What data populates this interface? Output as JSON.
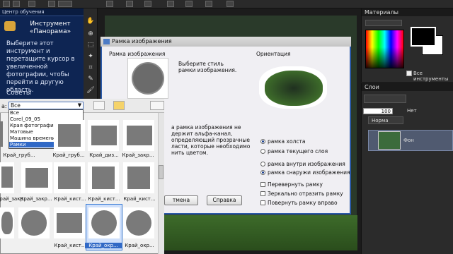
{
  "learning_center": {
    "header": "Центр обучения",
    "title": "Инструмент «Панорама»",
    "body": "Выберите этот инструмент и перетащите курсор в увеличенной фотографии, чтобы перейти в другую область.",
    "tips": "Советы"
  },
  "materials": {
    "header": "Материалы",
    "all_tools": "Все инструменты"
  },
  "layers": {
    "header": "Слои",
    "opacity": "100",
    "none_label": "Нет",
    "blend_mode": "Норма",
    "layer_name": "Фон"
  },
  "dialog": {
    "title": "Рамка изображения",
    "frame_section": "Рамка изображения",
    "choose_text": "Выберите стиль рамки изображения.",
    "orientation_section": "Ориентация",
    "info_text": "а рамка изображения не держит альфа-канал, определяющий прозрачные ласти, которые необходимо нить цветом.",
    "options": [
      {
        "label": "рамка холста",
        "type": "radio",
        "checked": true
      },
      {
        "label": "рамка текущего слоя",
        "type": "radio",
        "checked": false
      },
      {
        "label": "рамка внутри изображения",
        "type": "radio",
        "checked": false
      },
      {
        "label": "рамка снаружи изображения",
        "type": "radio",
        "checked": true
      },
      {
        "label": "Перевернуть рамку",
        "type": "checkbox",
        "checked": false
      },
      {
        "label": "Зеркально отразить рамку",
        "type": "checkbox",
        "checked": false
      },
      {
        "label": "Повернуть рамку вправо",
        "type": "checkbox",
        "checked": false
      }
    ],
    "cancel_label": "тмена",
    "help_label": "Справка"
  },
  "browser": {
    "combo_label": "а:",
    "combo_value": "Все",
    "dropdown_options": [
      {
        "label": "Все",
        "selected": false
      },
      {
        "label": "Corel_09_05",
        "selected": false
      },
      {
        "label": "Края фотографии",
        "selected": false
      },
      {
        "label": "Матовые",
        "selected": false
      },
      {
        "label": "Машина времени",
        "selected": false
      },
      {
        "label": "Рамки",
        "selected": true
      }
    ],
    "thumbnails": [
      {
        "label": "Край_груб...",
        "selected": false
      },
      {
        "label": "Край_груб...",
        "selected": false
      },
      {
        "label": "Край_диз...",
        "selected": false
      },
      {
        "label": "Край_закр...",
        "selected": false
      },
      {
        "label": "Край_закр...",
        "selected": false
      },
      {
        "label": "Край_закр...",
        "selected": false
      },
      {
        "label": "Край_кист...",
        "selected": false
      },
      {
        "label": "Край_кист...",
        "selected": false
      },
      {
        "label": "Край_кист...",
        "selected": false
      },
      {
        "label": "Край_кист...",
        "selected": false
      },
      {
        "label": "Край_окр...",
        "selected": true
      },
      {
        "label": "Край_окр...",
        "selected": false
      }
    ]
  }
}
